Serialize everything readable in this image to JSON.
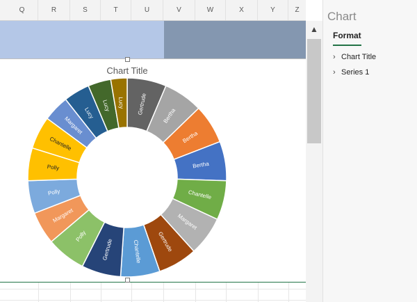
{
  "columns": [
    "Q",
    "R",
    "S",
    "T",
    "U",
    "V",
    "W",
    "X",
    "Y",
    "Z"
  ],
  "chart": {
    "title": "Chart Title"
  },
  "chart_data": {
    "type": "doughnut",
    "title": "Chart Title",
    "slices": [
      {
        "label": "Gertrude",
        "value": 6.0,
        "color": "#636363",
        "text_color": "#ffffff"
      },
      {
        "label": "Bertha",
        "value": 6.0,
        "color": "#a5a5a5",
        "text_color": "#ffffff"
      },
      {
        "label": "Bertha",
        "value": 6.0,
        "color": "#ed7d31",
        "text_color": "#ffffff"
      },
      {
        "label": "Bertha",
        "value": 6.0,
        "color": "#4472c4",
        "text_color": "#ffffff"
      },
      {
        "label": "Chantelle",
        "value": 6.0,
        "color": "#70ad47",
        "text_color": "#ffffff"
      },
      {
        "label": "Margaret",
        "value": 6.0,
        "color": "#b2b2b2",
        "text_color": "#ffffff"
      },
      {
        "label": "Gertrude",
        "value": 6.0,
        "color": "#9e480e",
        "text_color": "#ffffff"
      },
      {
        "label": "Chantelle",
        "value": 6.0,
        "color": "#5b9bd5",
        "text_color": "#ffffff"
      },
      {
        "label": "Gertrude",
        "value": 6.0,
        "color": "#264478",
        "text_color": "#ffffff"
      },
      {
        "label": "Polly",
        "value": 6.0,
        "color": "#8cc168",
        "text_color": "#ffffff"
      },
      {
        "label": "Margaret",
        "value": 5.0,
        "color": "#f1975a",
        "text_color": "#ffffff"
      },
      {
        "label": "Polly",
        "value": 5.0,
        "color": "#7caadd",
        "text_color": "#ffffff"
      },
      {
        "label": "Polly",
        "value": 5.0,
        "color": "#ffc000",
        "text_color": "#222222"
      },
      {
        "label": "Chantelle",
        "value": 5.0,
        "color": "#ffc000",
        "text_color": "#222222"
      },
      {
        "label": "Margaret",
        "value": 4.0,
        "color": "#698ed0",
        "text_color": "#ffffff"
      },
      {
        "label": "Lucy",
        "value": 4.0,
        "color": "#255e91",
        "text_color": "#ffffff"
      },
      {
        "label": "Lucy",
        "value": 3.5,
        "color": "#43682b",
        "text_color": "#ffffff"
      },
      {
        "label": "Lucy",
        "value": 2.5,
        "color": "#997300",
        "text_color": "#ffffff"
      }
    ]
  },
  "pane": {
    "title": "Chart",
    "tab": "Format",
    "items": [
      {
        "label": "Chart Title",
        "icon": "chevron-right-icon"
      },
      {
        "label": "Series 1",
        "icon": "chevron-right-icon"
      }
    ]
  },
  "scroll": {
    "up_icon": "▲"
  }
}
